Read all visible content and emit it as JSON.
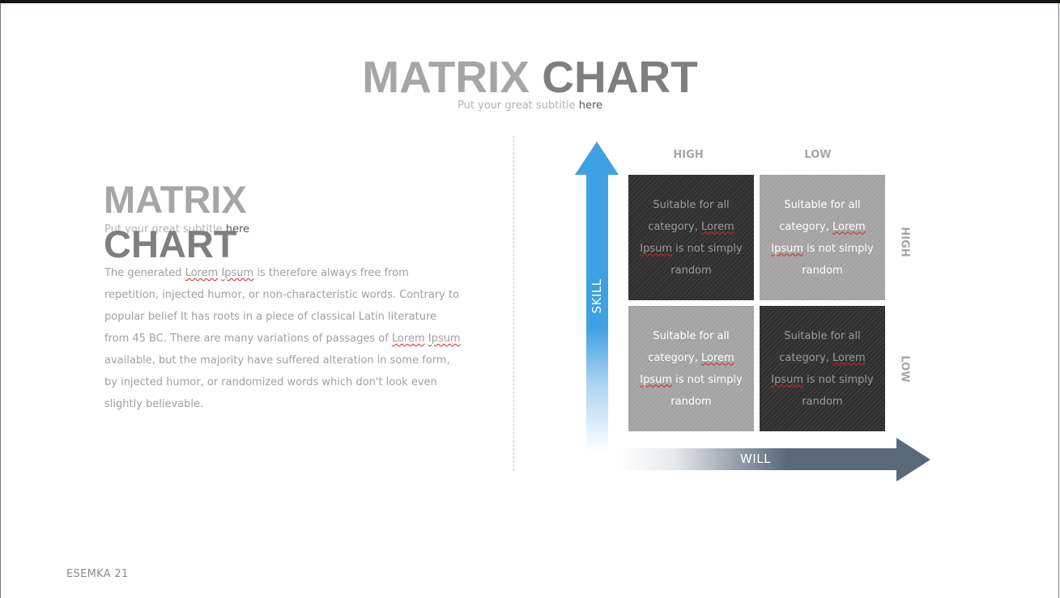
{
  "slide": {
    "title_part1": "MATRIX",
    "title_part2": "CHART",
    "subtitle_part1": "Put your great subtitle ",
    "subtitle_part2": "here"
  },
  "left_panel": {
    "title_line1": "MATRIX",
    "title_line2": "CHART",
    "subtitle_part1": "Put your great subtitle ",
    "subtitle_part2": "here",
    "body": {
      "seg1": "The generated ",
      "seg2": "Lorem",
      "seg3": " ",
      "seg4": "Ipsum",
      "seg5": " is therefore always free from repetition, injected humor, or non-characteristic words. Contrary to popular belief It has roots in a piece of classical Latin literature from 45 BC. There are many variations of passages of ",
      "seg6": "Lorem",
      "seg7": " ",
      "seg8": "Ipsum",
      "seg9": " available, but the majority have suffered alteration in some form, by injected humor, or randomized words which don't look even slightly believable."
    }
  },
  "matrix": {
    "y_axis_label": "SKILL",
    "x_axis_label": "WILL",
    "column_labels": [
      "HIGH",
      "LOW"
    ],
    "row_labels": [
      "HIGH",
      "LOW"
    ],
    "colors": {
      "skill_arrow": "#3ea1e3",
      "will_arrow": "#5a6979",
      "dark_cell": "#2f2f2f",
      "light_cell": "#a3a3a3"
    },
    "cells": [
      {
        "position": "top-left",
        "style": "dark",
        "text1": "Suitable for all category, ",
        "text2": "Lorem",
        "text3": " ",
        "text4": "Ipsum",
        "text5": " is not simply random"
      },
      {
        "position": "top-right",
        "style": "light",
        "text1": "Suitable for all category, ",
        "text2": "Lorem",
        "text3": " ",
        "text4": "Ipsum",
        "text5": " is not simply random"
      },
      {
        "position": "bottom-left",
        "style": "light",
        "text1": "Suitable for all category, ",
        "text2": "Lorem",
        "text3": " ",
        "text4": "Ipsum",
        "text5": " is not simply random"
      },
      {
        "position": "bottom-right",
        "style": "dark",
        "text1": "Suitable for all category, ",
        "text2": "Lorem",
        "text3": " ",
        "text4": "Ipsum",
        "text5": " is not simply random"
      }
    ]
  },
  "footer": {
    "label": "ESEMKA 21"
  }
}
